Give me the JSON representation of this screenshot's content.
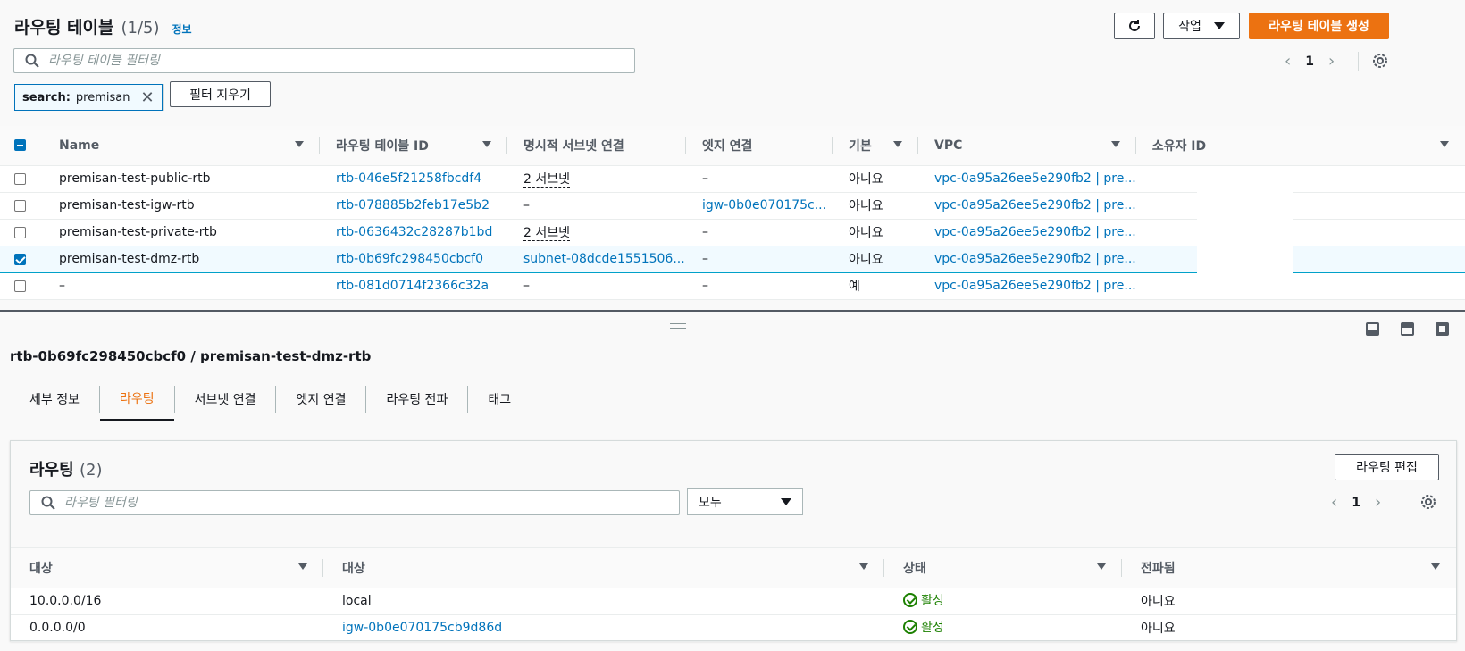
{
  "header": {
    "title": "라우팅 테이블",
    "count": "(1/5)",
    "info_link": "정보",
    "actions_label": "작업",
    "create_label": "라우팅 테이블 생성"
  },
  "filter": {
    "placeholder": "라우팅 테이블 필터링",
    "token_key": "search:",
    "token_value": "premisan",
    "clear_label": "필터 지우기",
    "page": "1"
  },
  "route_tables": {
    "columns": [
      "Name",
      "라우팅 테이블 ID",
      "명시적 서브넷 연결",
      "엣지 연결",
      "기본",
      "VPC",
      "소유자 ID"
    ],
    "rows": [
      {
        "name": "premisan-test-public-rtb",
        "id": "rtb-046e5f21258fbcdf4",
        "subnet": "2 서브넷",
        "edge": "–",
        "main": "아니요",
        "vpc": "vpc-0a95a26ee5e290fb2 | pre...",
        "selected": false
      },
      {
        "name": "premisan-test-igw-rtb",
        "id": "rtb-078885b2feb17e5b2",
        "subnet": "–",
        "edge": "igw-0b0e070175c...",
        "main": "아니요",
        "vpc": "vpc-0a95a26ee5e290fb2 | pre...",
        "selected": false
      },
      {
        "name": "premisan-test-private-rtb",
        "id": "rtb-0636432c28287b1bd",
        "subnet": "2 서브넷",
        "edge": "–",
        "main": "아니요",
        "vpc": "vpc-0a95a26ee5e290fb2 | pre...",
        "selected": false
      },
      {
        "name": "premisan-test-dmz-rtb",
        "id": "rtb-0b69fc298450cbcf0",
        "subnet": "subnet-08dcde1551506...",
        "edge": "–",
        "main": "아니요",
        "vpc": "vpc-0a95a26ee5e290fb2 | pre...",
        "selected": true
      },
      {
        "name": "–",
        "id": "rtb-081d0714f2366c32a",
        "subnet": "–",
        "edge": "–",
        "main": "예",
        "vpc": "vpc-0a95a26ee5e290fb2 | pre...",
        "selected": false
      }
    ]
  },
  "detail": {
    "title": "rtb-0b69fc298450cbcf0 / premisan-test-dmz-rtb",
    "tabs": [
      "세부 정보",
      "라우팅",
      "서브넷 연결",
      "엣지 연결",
      "라우팅 전파",
      "태그"
    ],
    "active_tab": "라우팅"
  },
  "routes": {
    "title": "라우팅",
    "count": "(2)",
    "edit_label": "라우팅 편집",
    "filter_placeholder": "라우팅 필터링",
    "select_value": "모두",
    "page": "1",
    "columns": [
      "대상",
      "대상",
      "상태",
      "전파됨"
    ],
    "rows": [
      {
        "destination": "10.0.0.0/16",
        "target": "local",
        "target_link": false,
        "status": "활성",
        "propagated": "아니요"
      },
      {
        "destination": "0.0.0.0/0",
        "target": "igw-0b0e070175cb9d86d",
        "target_link": true,
        "status": "활성",
        "propagated": "아니요"
      }
    ]
  },
  "colors": {
    "accent": "#ec7211",
    "link": "#0073bb",
    "success": "#1d8102"
  }
}
